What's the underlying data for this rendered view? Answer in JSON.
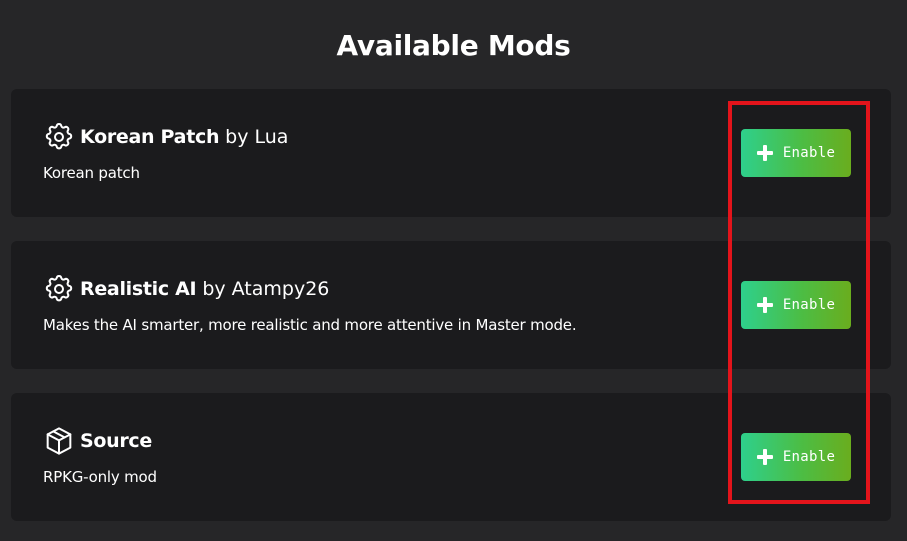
{
  "header": {
    "title": "Available Mods"
  },
  "mods": [
    {
      "name": "Korean Patch",
      "by_label": "by",
      "author": "Lua",
      "description": "Korean patch",
      "icon": "gear-icon",
      "button_label": "Enable"
    },
    {
      "name": "Realistic AI",
      "by_label": "by",
      "author": "Atampy26",
      "description": "Makes the AI smarter, more realistic and more attentive in Master mode.",
      "icon": "gear-icon",
      "button_label": "Enable"
    },
    {
      "name": "Source",
      "description": "RPKG-only mod",
      "icon": "package-icon",
      "button_label": "Enable"
    }
  ],
  "colors": {
    "background": "#262628",
    "card": "#1b1b1d",
    "button_gradient_start": "#2ed08c",
    "button_gradient_end": "#6aad1e",
    "highlight": "#e3141b"
  }
}
